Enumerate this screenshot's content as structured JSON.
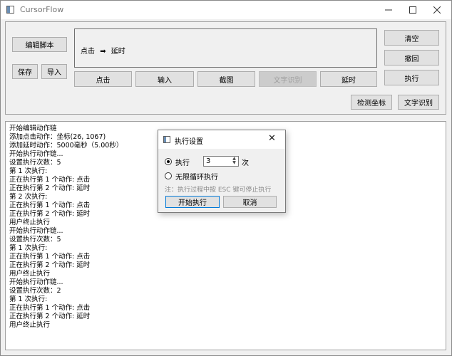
{
  "window": {
    "title": "CursorFlow"
  },
  "toolbar": {
    "edit_script": "编辑脚本",
    "save": "保存",
    "import": "导入",
    "chain_preview": {
      "step1": "点击",
      "arrow": "➡",
      "step2": "延时"
    },
    "click": "点击",
    "input": "输入",
    "screenshot": "截图",
    "ocr_disabled": "文字识别",
    "delay": "延时",
    "clear": "清空",
    "undo": "撤回",
    "execute": "执行",
    "detect_coords": "检测坐标",
    "ocr": "文字识别"
  },
  "log": [
    "开始编辑动作链",
    "添加点击动作：坐标(26, 1067)",
    "添加延时动作：5000毫秒（5.00秒）",
    "开始执行动作链...",
    "设置执行次数：5",
    "第 1 次执行:",
    "正在执行第 1 个动作: 点击",
    "正在执行第 2 个动作: 延时",
    "第 2 次执行:",
    "正在执行第 1 个动作: 点击",
    "正在执行第 2 个动作: 延时",
    "用户终止执行",
    "开始执行动作链...",
    "设置执行次数：5",
    "第 1 次执行:",
    "正在执行第 1 个动作: 点击",
    "正在执行第 2 个动作: 延时",
    "用户终止执行",
    "开始执行动作链...",
    "设置执行次数：2",
    "第 1 次执行:",
    "正在执行第 1 个动作: 点击",
    "正在执行第 2 个动作: 延时",
    "用户终止执行"
  ],
  "dialog": {
    "title": "执行设置",
    "option_execute": "执行",
    "count_value": "3",
    "count_unit": "次",
    "option_infinite": "无限循环执行",
    "note": "注：执行过程中按 ESC 键可停止执行",
    "start_button": "开始执行",
    "cancel_button": "取消"
  }
}
